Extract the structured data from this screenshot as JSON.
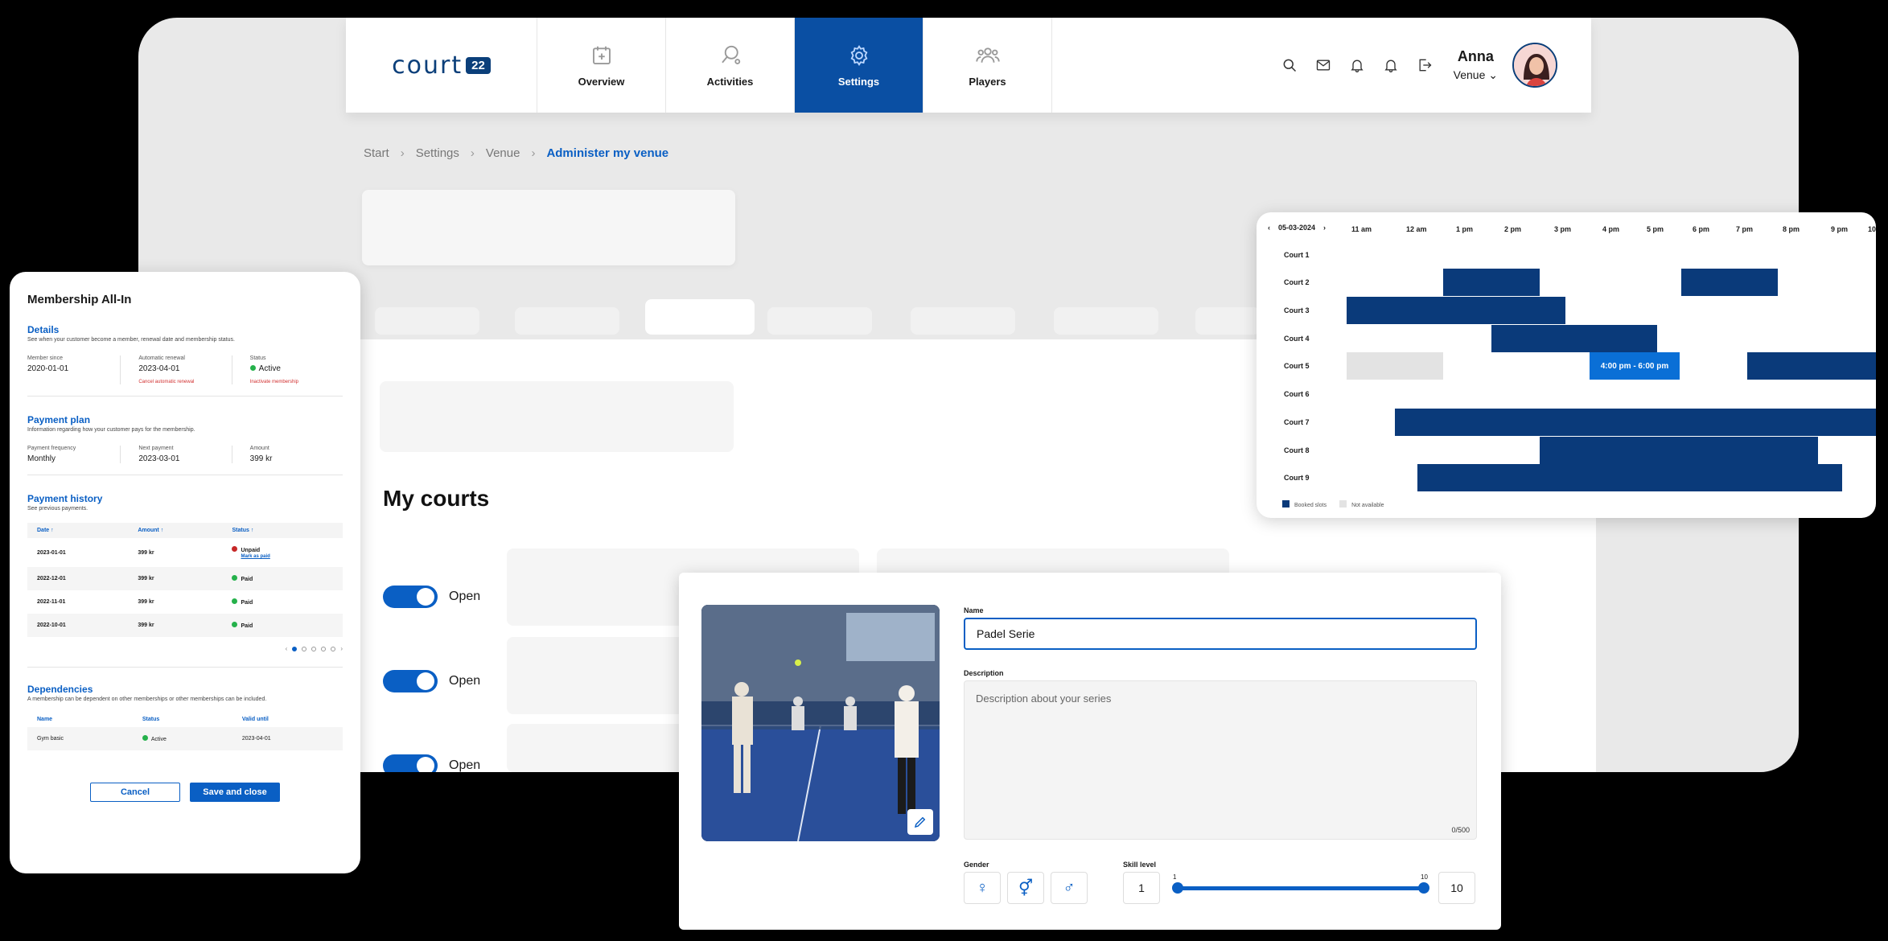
{
  "brand": {
    "logo_text": "court",
    "logo_badge": "22"
  },
  "nav": {
    "tabs": [
      {
        "label": "Overview",
        "icon": "calendar-plus-icon"
      },
      {
        "label": "Activities",
        "icon": "padel-racket-icon"
      },
      {
        "label": "Settings",
        "icon": "gear-icon",
        "active": true
      },
      {
        "label": "Players",
        "icon": "people-icon"
      }
    ],
    "icons": [
      "search-icon",
      "mail-icon",
      "bell-icon",
      "bell-icon",
      "logout-icon"
    ]
  },
  "user": {
    "name": "Anna",
    "role": "Venue"
  },
  "breadcrumb": {
    "items": [
      "Start",
      "Settings",
      "Venue"
    ],
    "current": "Administer my venue"
  },
  "page": {
    "heading": "My courts",
    "toggle_label": "Open"
  },
  "colors": {
    "primary": "#0a5fc4",
    "nav_active": "#0a4fa3",
    "booked": "#0a3a7a",
    "selected": "#0a6fd6",
    "not_available": "#e3e3e3",
    "status_active": "#25b14b",
    "status_unpaid": "#c62828"
  },
  "membership": {
    "title": "Membership All-In",
    "details": {
      "title": "Details",
      "subtitle": "See when your customer become a member, renewal date and membership status.",
      "member_since_label": "Member since",
      "member_since": "2020-01-01",
      "renewal_label": "Automatic renewal",
      "renewal": "2023-04-01",
      "renewal_link": "Cancel automatic renewal",
      "status_label": "Status",
      "status": "Active",
      "status_link": "Inactivate membership"
    },
    "plan": {
      "title": "Payment plan",
      "subtitle": "Information regarding how your customer pays for the membership.",
      "freq_label": "Payment frequency",
      "freq": "Monthly",
      "next_label": "Next payment",
      "next": "2023-03-01",
      "amount_label": "Amount",
      "amount": "399 kr"
    },
    "history": {
      "title": "Payment history",
      "subtitle": "See previous payments.",
      "headers": [
        "Date",
        "Amount",
        "Status"
      ],
      "rows": [
        {
          "date": "2023-01-01",
          "amount": "399 kr",
          "status": "Unpaid",
          "link": "Mark as paid"
        },
        {
          "date": "2022-12-01",
          "amount": "399 kr",
          "status": "Paid"
        },
        {
          "date": "2022-11-01",
          "amount": "399 kr",
          "status": "Paid"
        },
        {
          "date": "2022-10-01",
          "amount": "399 kr",
          "status": "Paid"
        }
      ]
    },
    "dependencies": {
      "title": "Dependencies",
      "subtitle": "A membership can be dependent on other memberships or other memberships can be included.",
      "headers": [
        "Name",
        "Status",
        "Valid until"
      ],
      "row": {
        "name": "Gym basic",
        "status": "Active",
        "valid": "2023-04-01"
      }
    },
    "cancel": "Cancel",
    "save": "Save and close"
  },
  "schedule": {
    "date": "05-03-2024",
    "times": [
      "11 am",
      "12 am",
      "1 pm",
      "2 pm",
      "3 pm",
      "4 pm",
      "5 pm",
      "6 pm",
      "7 pm",
      "8 pm",
      "9 pm",
      "10"
    ],
    "courts": [
      "Court 1",
      "Court 2",
      "Court 3",
      "Court 4",
      "Court 5",
      "Court 6",
      "Court 7",
      "Court 8",
      "Court 9"
    ],
    "selected_slot": "4:00 pm - 6:00 pm",
    "legend_booked": "Booked slots",
    "legend_na": "Not available"
  },
  "series": {
    "name_label": "Name",
    "name_value": "Padel Serie",
    "desc_label": "Description",
    "desc_placeholder": "Description about your series",
    "desc_count": "0/500",
    "gender_label": "Gender",
    "skill_label": "Skill level",
    "skill_min": "1",
    "skill_max": "10",
    "skill_min_tick": "1",
    "skill_max_tick": "10"
  }
}
